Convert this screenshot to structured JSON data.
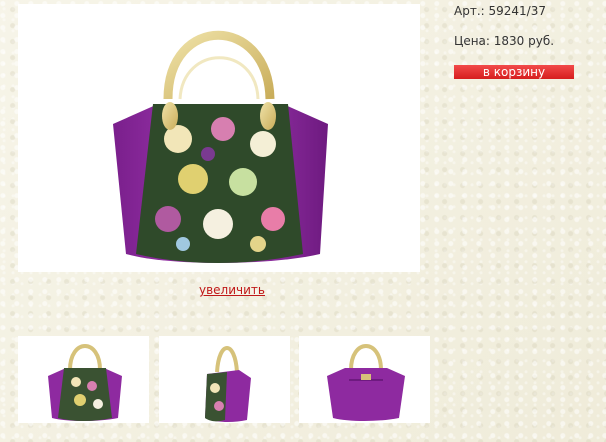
{
  "product": {
    "article": "Арт.: 59241/37",
    "price": "Цена: 1830 руб.",
    "cart_button": "в корзину"
  },
  "gallery": {
    "zoom_link": "увеличить",
    "thumbnails": [
      "front-view",
      "side-view",
      "back-view"
    ]
  },
  "colors": {
    "bag_purple": "#8e2aa0",
    "button_red": "#e23030",
    "link_red": "#c01818",
    "handle_gold": "#d6c27a"
  }
}
